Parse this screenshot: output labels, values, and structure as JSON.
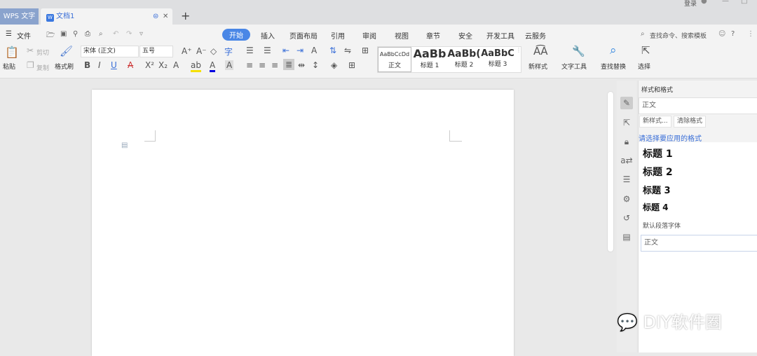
{
  "tabs": {
    "app": "WPS 文字",
    "doc": "文档1",
    "new_tab": "+",
    "login": "登录"
  },
  "menu": {
    "file": "文件",
    "items": [
      "开始",
      "插入",
      "页面布局",
      "引用",
      "审阅",
      "视图",
      "章节",
      "安全",
      "开发工具",
      "云服务"
    ],
    "search": "查找命令、搜索模板"
  },
  "ribbon": {
    "paste": "粘贴",
    "cut": "剪切",
    "copy": "复制",
    "format_painter": "格式刷",
    "font": "宋体 (正文)",
    "size": "五号",
    "styles": [
      {
        "preview": "AaBbCcDd",
        "name": "正文"
      },
      {
        "preview": "AaBb",
        "name": "标题 1"
      },
      {
        "preview": "AaBb(",
        "name": "标题 2"
      },
      {
        "preview": "AaBbC",
        "name": "标题 3"
      }
    ],
    "new_style": "新样式",
    "text_tools": "文字工具",
    "find_replace": "查找替换",
    "select": "选择"
  },
  "panel": {
    "title": "样式和格式",
    "current": "正文",
    "new_style_btn": "新样式...",
    "clear_btn": "清除格式",
    "prompt": "请选择要应用的格式",
    "list": [
      "标题 1",
      "标题 2",
      "标题 3",
      "标题 4"
    ],
    "default_font": "默认段落字体",
    "footer_select": "正文"
  },
  "watermark": "DIY软件圈",
  "colors": {
    "accent": "#4a87e6"
  }
}
